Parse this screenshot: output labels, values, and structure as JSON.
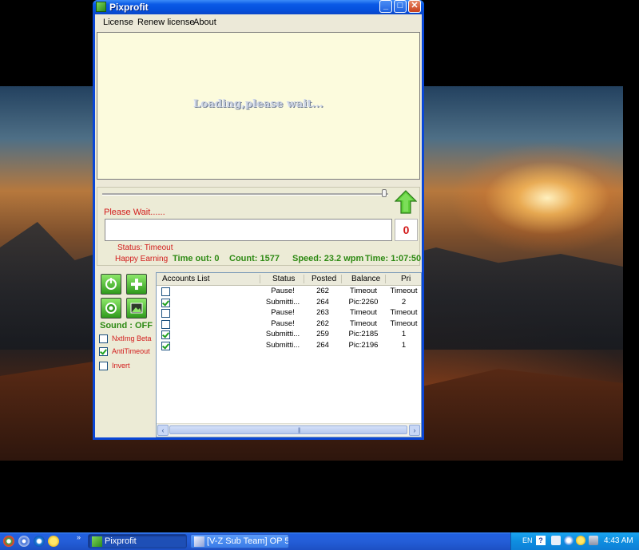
{
  "window": {
    "title": "Pixprofit",
    "controls": {
      "minimize": "_",
      "maximize": "□",
      "close": "✕"
    }
  },
  "menu": {
    "license": "License",
    "renew_license": "Renew license",
    "about": "About"
  },
  "browser": {
    "loading_text": "Loading,please wait..."
  },
  "progress": {
    "please_wait": "Please Wait......",
    "counter": "0",
    "status": "Status: Timeout",
    "happy": "Happy Earning",
    "timeout": "Time out: 0",
    "count": "Count: 1577",
    "speed": "Speed: 23.2 wpm",
    "time": "Time: 1:07:50"
  },
  "tools": {
    "sound": "Sound : OFF",
    "options": [
      {
        "label": "NxtImg Beta",
        "checked": false
      },
      {
        "label": "AntiTimeout",
        "checked": true
      },
      {
        "label": "Invert",
        "checked": false
      }
    ]
  },
  "accounts": {
    "columns": [
      "Accounts List",
      "Status",
      "Posted",
      "Balance",
      "Pri"
    ],
    "rows": [
      {
        "checked": false,
        "status": "Pause!",
        "posted": "262",
        "balance": "Timeout",
        "pri": "Timeout"
      },
      {
        "checked": true,
        "status": "Submitti...",
        "posted": "264",
        "balance": "Pic:2260",
        "pri": "2"
      },
      {
        "checked": false,
        "status": "Pause!",
        "posted": "263",
        "balance": "Timeout",
        "pri": "Timeout"
      },
      {
        "checked": false,
        "status": "Pause!",
        "posted": "262",
        "balance": "Timeout",
        "pri": "Timeout"
      },
      {
        "checked": true,
        "status": "Submitti...",
        "posted": "259",
        "balance": "Pic:2185",
        "pri": "1"
      },
      {
        "checked": true,
        "status": "Submitti...",
        "posted": "264",
        "balance": "Pic:2196",
        "pri": "1"
      }
    ],
    "scroll_left": "‹",
    "scroll_right": "›",
    "scroll_grip": "|||"
  },
  "taskbar": {
    "tasks": [
      {
        "label": "Pixprofit",
        "active": true
      },
      {
        "label": "[V-Z Sub Team] OP 5...",
        "active": false
      }
    ],
    "quicklaunch_more": "»",
    "language": "EN",
    "help": "?",
    "clock": "4:43 AM"
  },
  "colors": {
    "title_blue": "#0a5ae6",
    "status_red": "#d21a1a",
    "stat_green": "#2e8a14",
    "loading_bg": "#fcfbdd"
  }
}
